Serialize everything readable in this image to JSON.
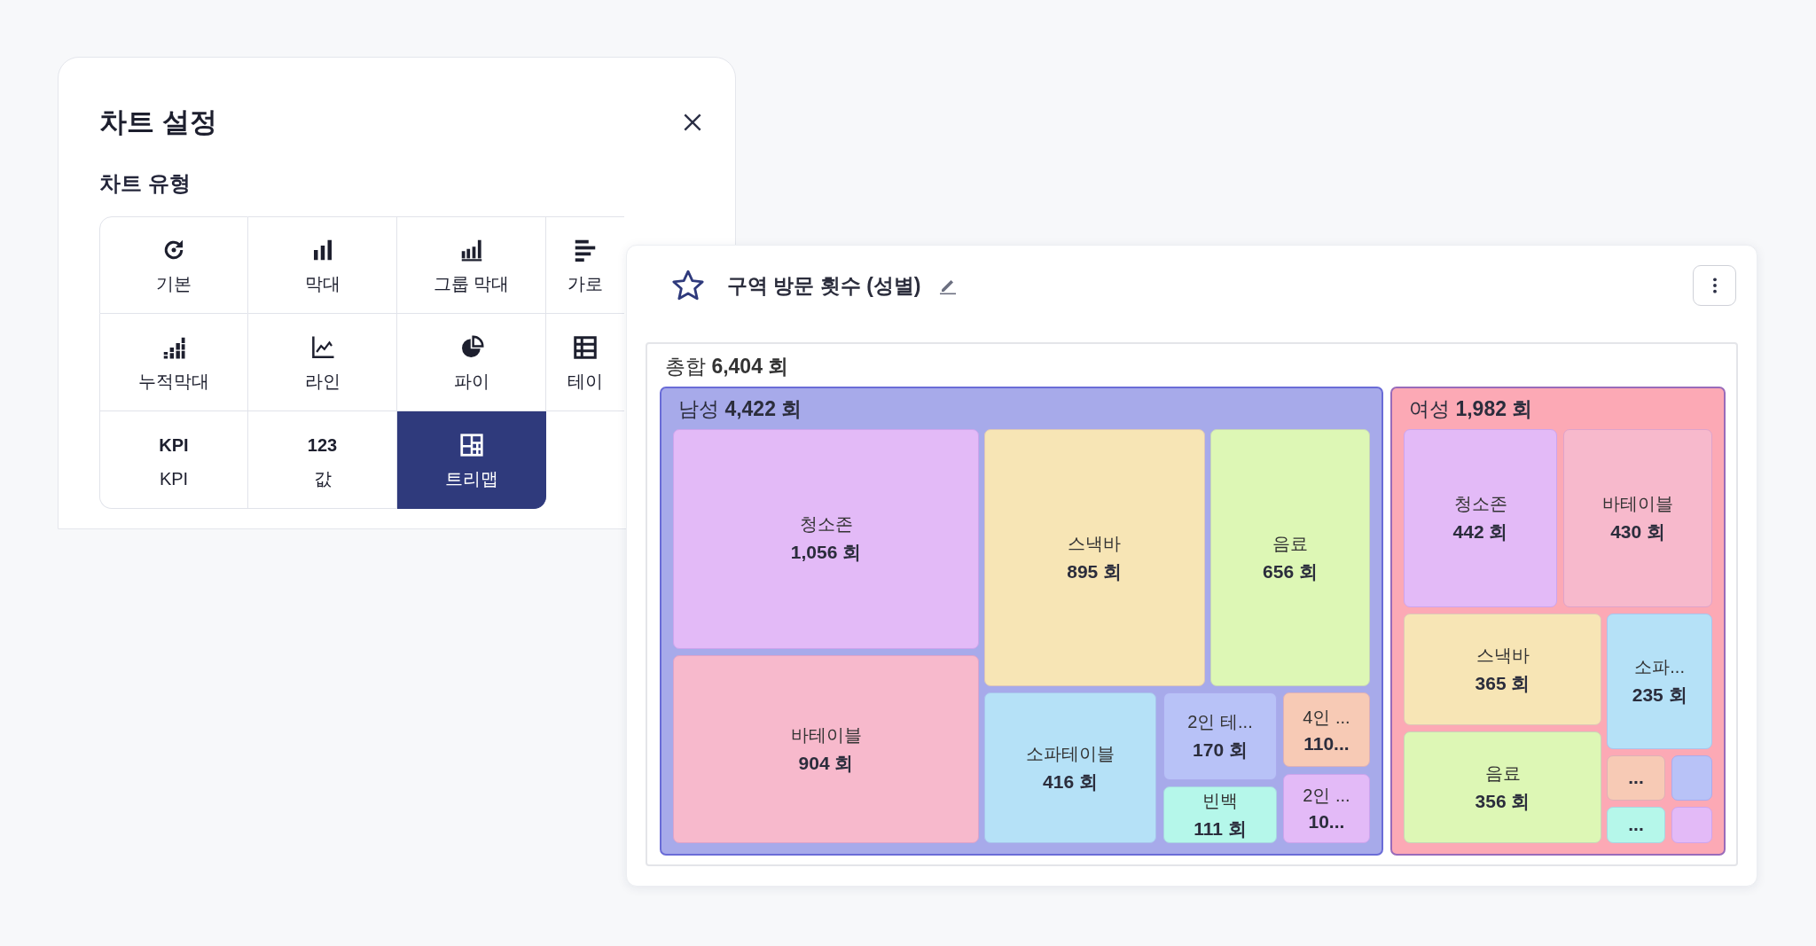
{
  "panel": {
    "title": "차트 설정",
    "section_label": "차트 유형",
    "chart_types": [
      {
        "label": "기본",
        "selected": false
      },
      {
        "label": "막대",
        "selected": false
      },
      {
        "label": "그룹 막대",
        "selected": false
      },
      {
        "label": "가로",
        "selected": false
      },
      {
        "label": "누적막대",
        "selected": false
      },
      {
        "label": "라인",
        "selected": false
      },
      {
        "label": "파이",
        "selected": false
      },
      {
        "label": "테이",
        "selected": false
      },
      {
        "glyph": "KPI",
        "label": "KPI",
        "selected": false
      },
      {
        "glyph": "123",
        "label": "값",
        "selected": false
      },
      {
        "label": "트리맵",
        "selected": true
      }
    ]
  },
  "card": {
    "title": "구역 방문 횟수 (성별)",
    "total": "총합 **6,404 회**",
    "groups": [
      {
        "label": "남성 **4,422 회**",
        "color": "#a7aaea",
        "tiles": [
          {
            "name": "청소존",
            "value": "1,056 회",
            "color": "#e3baf7"
          },
          {
            "name": "바테이블",
            "value": "904 회",
            "color": "#f7b9cc"
          },
          {
            "name": "스낵바",
            "value": "895 회",
            "color": "#f7e5b5"
          },
          {
            "name": "음료",
            "value": "656 회",
            "color": "#ddf7b5"
          },
          {
            "name": "소파테이블",
            "value": "416 회",
            "color": "#b5e1f7"
          },
          {
            "name": "2인 테...",
            "value": "170 회",
            "color": "#b8c2f7"
          },
          {
            "name": "빈백",
            "value": "111 회",
            "color": "#b5f7ea"
          },
          {
            "name": "4인 ...",
            "value": "110...",
            "color": "#f7cab5"
          },
          {
            "name": "2인 ...",
            "value": "10...",
            "color": "#e3baf7"
          }
        ]
      },
      {
        "label": "여성 **1,982 회**",
        "color": "#fca9b5",
        "tiles": [
          {
            "name": "청소존",
            "value": "442 회",
            "color": "#e3baf7"
          },
          {
            "name": "바테이블",
            "value": "430 회",
            "color": "#f7b9cc"
          },
          {
            "name": "스낵바",
            "value": "365 회",
            "color": "#f7e5b5"
          },
          {
            "name": "음료",
            "value": "356 회",
            "color": "#ddf7b5"
          },
          {
            "name": "소파...",
            "value": "235 회",
            "color": "#b5e1f7"
          },
          {
            "value": "...",
            "color": "#f7cab5"
          },
          {
            "color": "#b8c2f7"
          },
          {
            "value": "...",
            "color": "#b5f7ea"
          },
          {
            "color": "#e3baf7"
          }
        ]
      }
    ]
  }
}
